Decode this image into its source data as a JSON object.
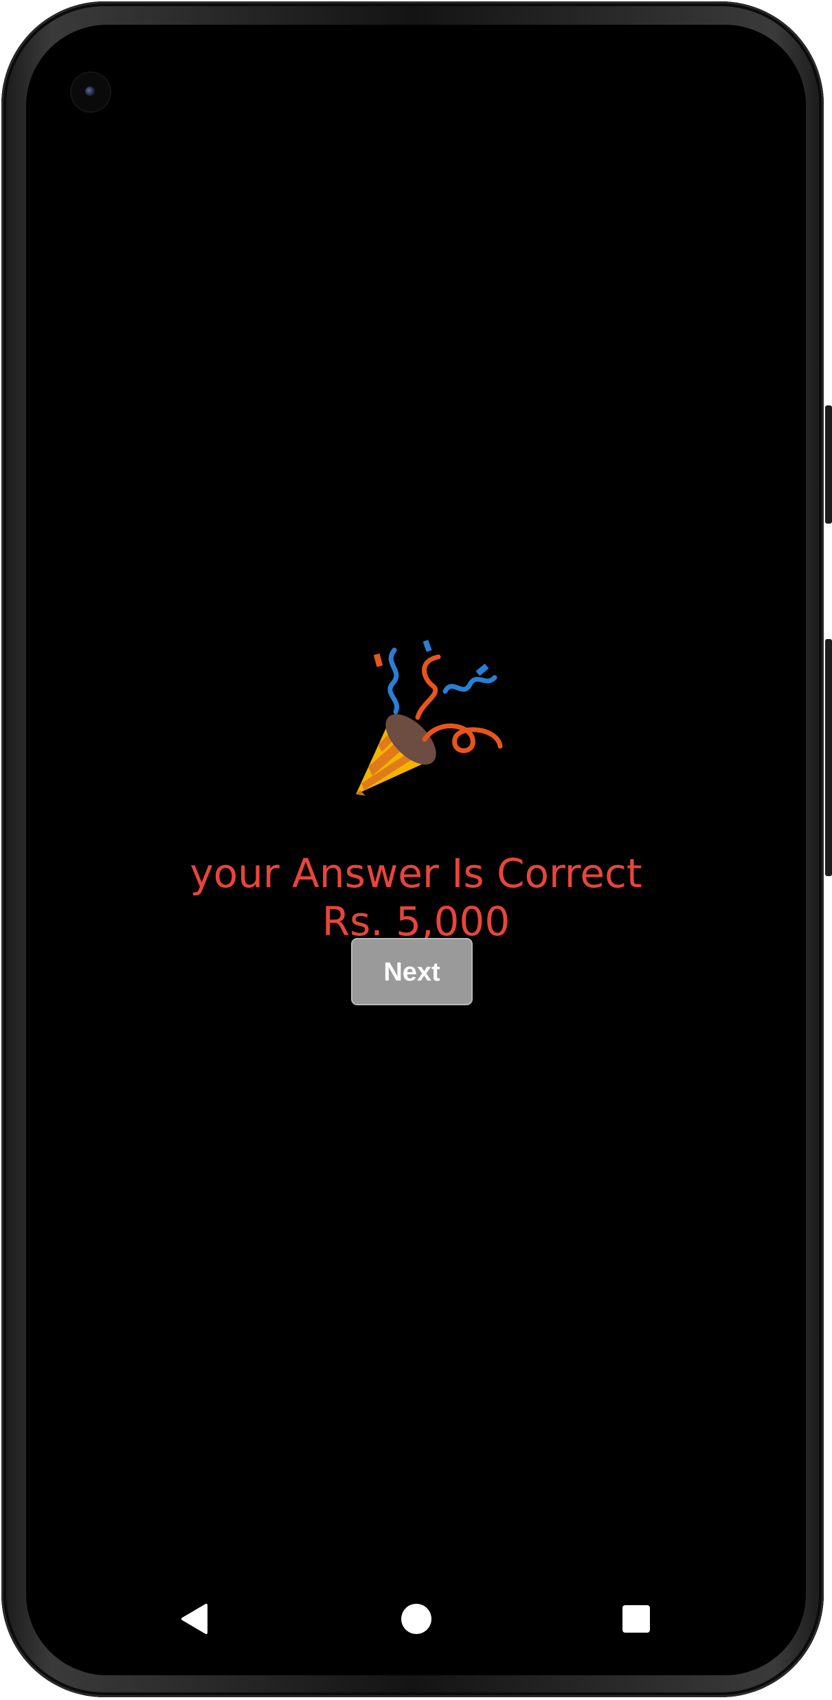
{
  "result": {
    "icon": "party-popper-icon",
    "message": "your Answer Is Correct",
    "prize": "Rs. 5,000",
    "next_label": "Next"
  },
  "nav": {
    "back_icon": "back-triangle-icon",
    "home_icon": "home-circle-icon",
    "recents_icon": "recents-square-icon"
  },
  "colors": {
    "background": "#000000",
    "message": "#e8453c",
    "button_bg": "#9a9a9a",
    "button_text": "#ffffff"
  }
}
